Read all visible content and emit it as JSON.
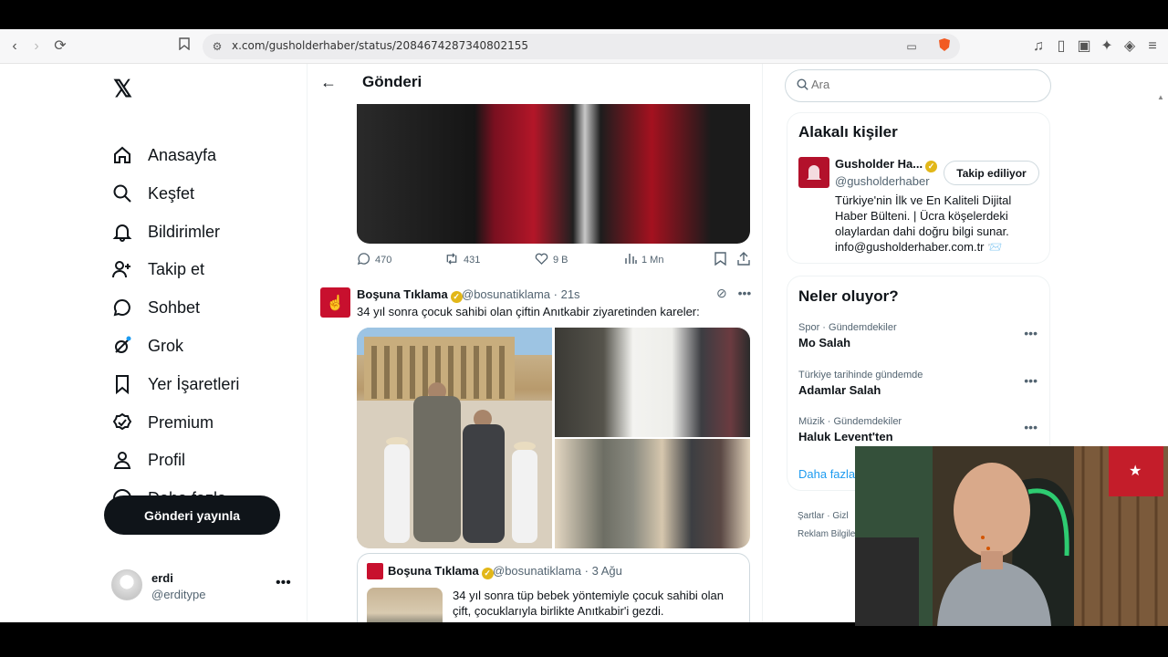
{
  "browser": {
    "url": "x.com/gusholderhaber/status/2084674287340802155"
  },
  "nav": {
    "logo": "𝕏",
    "items": [
      {
        "label": "Anasayfa",
        "icon": "home-icon"
      },
      {
        "label": "Keşfet",
        "icon": "search-icon"
      },
      {
        "label": "Bildirimler",
        "icon": "bell-icon"
      },
      {
        "label": "Takip et",
        "icon": "follow-icon"
      },
      {
        "label": "Sohbet",
        "icon": "chat-icon"
      },
      {
        "label": "Grok",
        "icon": "grok-icon"
      },
      {
        "label": "Yer İşaretleri",
        "icon": "bookmark-icon"
      },
      {
        "label": "Premium",
        "icon": "premium-icon"
      },
      {
        "label": "Profil",
        "icon": "profile-icon"
      },
      {
        "label": "Daha fazla",
        "icon": "more-icon"
      }
    ],
    "post_button": "Gönderi yayınla",
    "user_name": "erdi",
    "user_handle": "@erditype"
  },
  "header": {
    "title": "Gönderi"
  },
  "tweet1": {
    "replies": "470",
    "retweets": "431",
    "likes": "9 B",
    "views": "1 Mn"
  },
  "tweet2": {
    "name": "Boşuna Tıklama",
    "handle": "@bosunatiklama",
    "time": "· 21s",
    "text": "34 yıl sonra çocuk sahibi olan çiftin Anıtkabir ziyaretinden kareler:"
  },
  "quote": {
    "name": "Boşuna Tıklama",
    "handle": "@bosunatiklama",
    "time": "· 3 Ağu",
    "text": "34 yıl sonra tüp bebek yöntemiyle çocuk sahibi olan çift, çocuklarıyla birlikte Anıtkabir'i gezdi."
  },
  "search": {
    "placeholder": "Ara"
  },
  "related": {
    "title": "Alakalı kişiler",
    "name": "Gusholder Ha...",
    "handle": "@gusholderhaber",
    "follow_label": "Takip ediliyor",
    "bio": "Türkiye'nin İlk ve En Kaliteli Dijital Haber Bülteni. | Ücra köşelerdeki olaylardan dahi doğru bilgi sunar. info@gusholderhaber.com.tr 📨"
  },
  "trends": {
    "title": "Neler oluyor?",
    "items": [
      {
        "category": "Spor · Gündemdekiler",
        "title": "Mo Salah"
      },
      {
        "category": "Türkiye tarihinde gündemde",
        "title": "Adamlar Salah"
      },
      {
        "category": "Müzik · Gündemdekiler",
        "title": "Haluk Levent'ten"
      }
    ],
    "show_more": "Daha fazla"
  },
  "footer": {
    "line1": "Şartlar · Gizl",
    "line2": "Reklam Bilgiler"
  },
  "colors": {
    "accent": "#1d9bf0",
    "brand_red": "#c8102e",
    "verified_gold": "#e2b719"
  }
}
